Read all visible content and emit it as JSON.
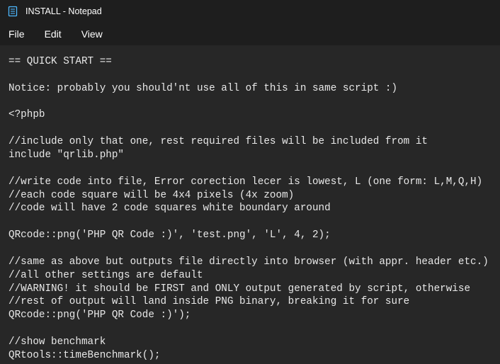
{
  "window": {
    "title": "INSTALL - Notepad"
  },
  "menu": {
    "file": "File",
    "edit": "Edit",
    "view": "View"
  },
  "document": {
    "content": "== QUICK START ==\n\nNotice: probably you should'nt use all of this in same script :)\n\n<?phpb\n\n//include only that one, rest required files will be included from it\ninclude \"qrlib.php\"\n\n//write code into file, Error corection lecer is lowest, L (one form: L,M,Q,H)\n//each code square will be 4x4 pixels (4x zoom)\n//code will have 2 code squares white boundary around\n\nQRcode::png('PHP QR Code :)', 'test.png', 'L', 4, 2);\n\n//same as above but outputs file directly into browser (with appr. header etc.)\n//all other settings are default\n//WARNING! it should be FIRST and ONLY output generated by script, otherwise\n//rest of output will land inside PNG binary, breaking it for sure\nQRcode::png('PHP QR Code :)');\n\n//show benchmark\nQRtools::timeBenchmark();"
  }
}
